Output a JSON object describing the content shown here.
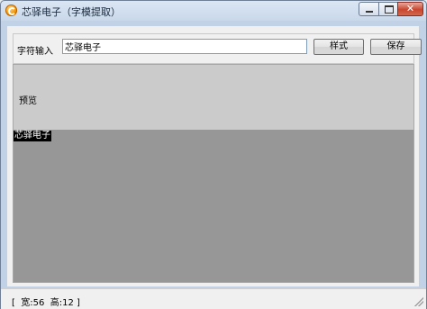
{
  "window": {
    "title": "芯驿电子（字模提取）",
    "icon": "app-logo-icon"
  },
  "toolbar": {
    "input_label": "字符输入",
    "input_value": "芯驿电子",
    "style_button": "样式",
    "save_button": "保存"
  },
  "preview": {
    "label": "预览",
    "rendered_text": "芯驿电子"
  },
  "status": {
    "text": "[  宽:56  高:12 ]"
  },
  "colors": {
    "preview_bg": "#cbcbcb",
    "canvas_bg": "#979797",
    "glyph_bg": "#000000",
    "glyph_fg": "#ffffff"
  }
}
